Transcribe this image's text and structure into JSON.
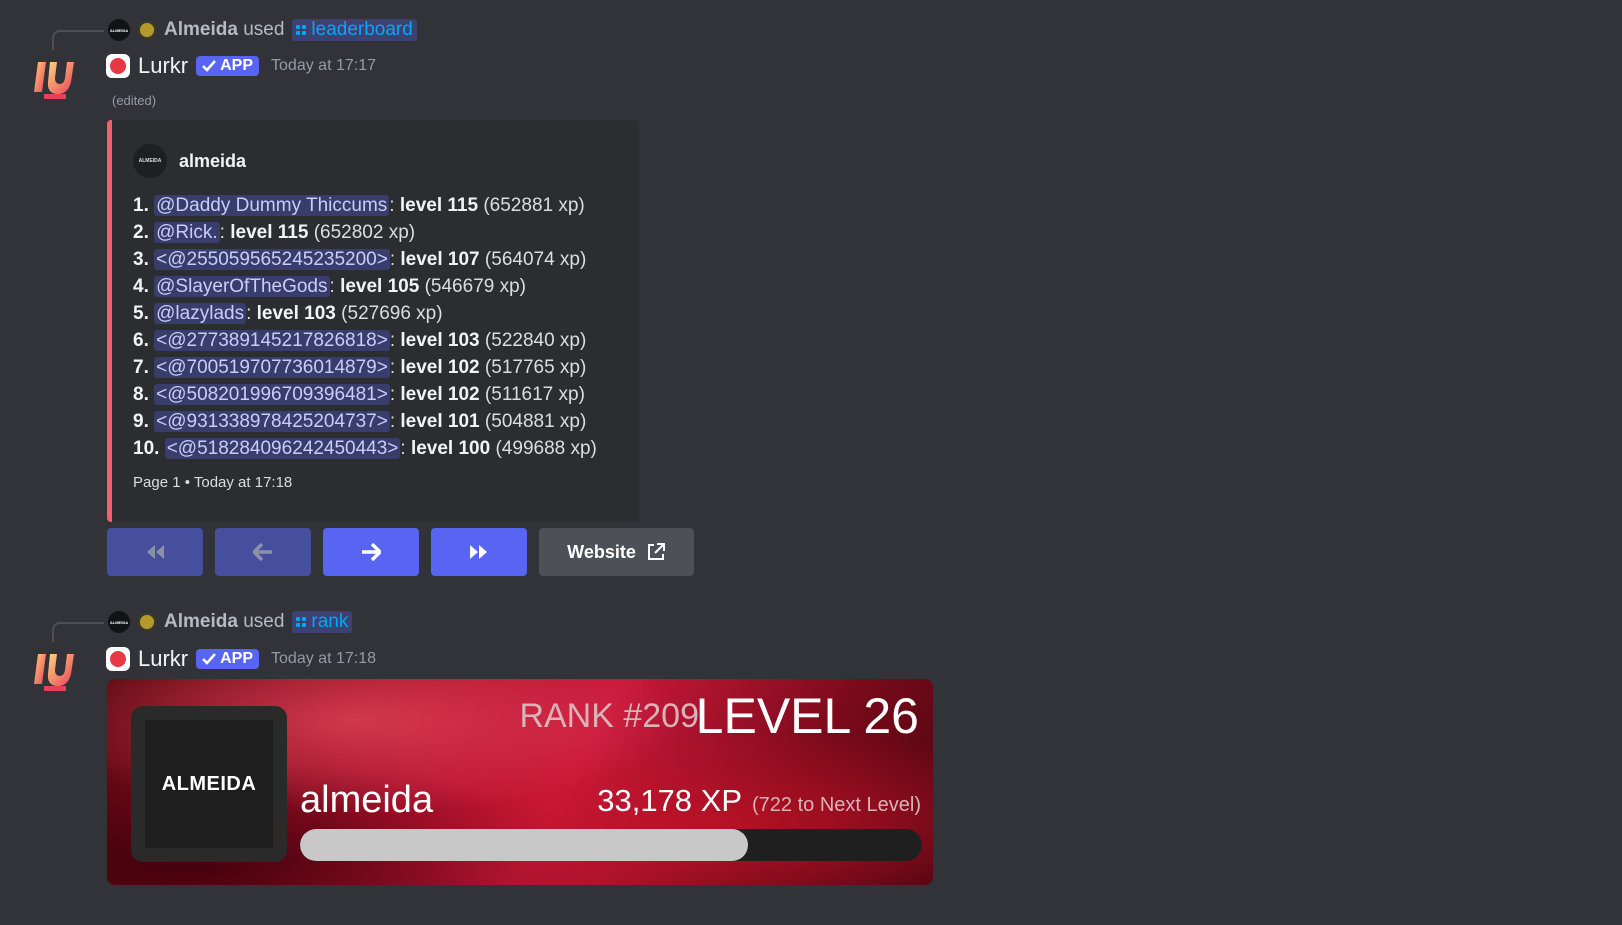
{
  "messages": [
    {
      "reply": {
        "user": "Almeida",
        "used_text": "used",
        "command": "leaderboard",
        "avatar_text": "ALMEIDA"
      },
      "bot": {
        "name": "Lurkr",
        "tag": "APP",
        "time": "Today at 17:17",
        "edited": "(edited)"
      },
      "embed": {
        "author": "almeida",
        "author_avatar_text": "ALMEIDA",
        "accent_color": "#f0616a",
        "entries": [
          {
            "rank": "1.",
            "mention": "@Daddy Dummy Thiccums",
            "level": "level 115",
            "xp": "(652881 xp)"
          },
          {
            "rank": "2.",
            "mention": "@Rick.",
            "level": "level 115",
            "xp": "(652802 xp)"
          },
          {
            "rank": "3.",
            "mention": "<@255059565245235200>",
            "level": "level 107",
            "xp": "(564074 xp)"
          },
          {
            "rank": "4.",
            "mention": "@SlayerOfTheGods",
            "level": "level 105",
            "xp": "(546679 xp)"
          },
          {
            "rank": "5.",
            "mention": "@lazylads",
            "level": "level 103",
            "xp": "(527696 xp)"
          },
          {
            "rank": "6.",
            "mention": "<@277389145217826818>",
            "level": "level 103",
            "xp": "(522840 xp)"
          },
          {
            "rank": "7.",
            "mention": "<@700519707736014879>",
            "level": "level 102",
            "xp": "(517765 xp)"
          },
          {
            "rank": "8.",
            "mention": "<@508201996709396481>",
            "level": "level 102",
            "xp": "(511617 xp)"
          },
          {
            "rank": "9.",
            "mention": "<@931338978425204737>",
            "level": "level 101",
            "xp": "(504881 xp)"
          },
          {
            "rank": "10.",
            "mention": "<@518284096242450443>",
            "level": "level 100",
            "xp": "(499688 xp)"
          }
        ],
        "footer": "Page 1 • Today at 17:18"
      },
      "buttons": {
        "first_icon": "double-arrow-left-icon",
        "prev_icon": "arrow-left-icon",
        "next_icon": "arrow-right-icon",
        "last_icon": "double-arrow-right-icon",
        "website_label": "Website",
        "website_icon": "external-link-icon"
      }
    },
    {
      "reply": {
        "user": "Almeida",
        "used_text": "used",
        "command": "rank",
        "avatar_text": "ALMEIDA"
      },
      "bot": {
        "name": "Lurkr",
        "tag": "APP",
        "time": "Today at 17:18"
      },
      "rank_card": {
        "rank": "RANK #209",
        "level": "LEVEL 26",
        "username": "almeida",
        "avatar_text": "ALMEIDA",
        "xp": "33,178 XP",
        "to_next": "(722 to Next Level)",
        "progress": 0.72
      }
    }
  ]
}
